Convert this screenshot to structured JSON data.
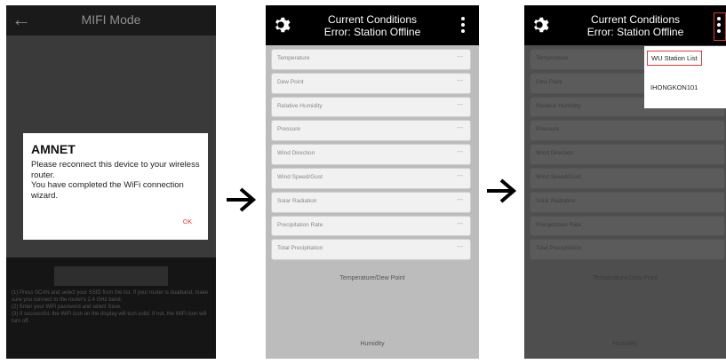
{
  "screen1": {
    "back_glyph": "←",
    "title": "MIFI Mode",
    "dialog": {
      "heading": "AMNET",
      "message": "Please reconnect this device to your wireless router.\nYou have completed the WiFi connection wizard.",
      "ok": "OK"
    },
    "instructions": "(1) Press SCAN and select your SSID from the list. If your router is dualband, make sure you connect to the router's 2.4 GHz band.\n(2) Enter your WiFi password and select Save.\n(3) If successful, the WiFi icon on the display will turn solid. If not, the WiFi icon will turn off."
  },
  "screen2": {
    "header_line1": "Current Conditions",
    "header_line2": "Error: Station Offline",
    "rows": [
      {
        "label": "Temperature",
        "value": "---"
      },
      {
        "label": "Dew Point",
        "value": "---"
      },
      {
        "label": "Relative Humidity",
        "value": "---"
      },
      {
        "label": "Pressure",
        "value": "---"
      },
      {
        "label": "Wind Direction",
        "value": "---"
      },
      {
        "label": "Wind Speed/Gust",
        "value": "---"
      },
      {
        "label": "Solar Radiation",
        "value": "---"
      },
      {
        "label": "Precipitation Rate",
        "value": "---"
      },
      {
        "label": "Total Precipitation",
        "value": "---"
      }
    ],
    "section1": "Temperature/Dew Point",
    "section2": "Humidity"
  },
  "screen3": {
    "header_line1": "Current Conditions",
    "header_line2": "Error: Station Offline",
    "menu": [
      "WU Station List",
      "IHONGKON101"
    ],
    "rows": [
      {
        "label": "Temperature"
      },
      {
        "label": "Dew Point"
      },
      {
        "label": "Relative Humidity"
      },
      {
        "label": "Pressure"
      },
      {
        "label": "Wind Direction"
      },
      {
        "label": "Wind Speed/Gust"
      },
      {
        "label": "Solar Radiation"
      },
      {
        "label": "Precipitation Rate"
      },
      {
        "label": "Total Precipitation"
      }
    ],
    "section1": "Temperature/Dew Point",
    "section2": "Humidity"
  },
  "colors": {
    "accent_red": "#e53935",
    "header_black": "#000000"
  },
  "icons": [
    "back-arrow-icon",
    "gear-icon",
    "kebab-menu-icon",
    "right-arrow-icon"
  ]
}
